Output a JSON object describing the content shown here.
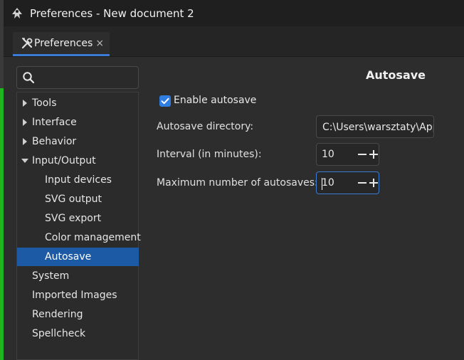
{
  "window": {
    "title": "Preferences - New document 2"
  },
  "tab": {
    "label": "Preferences",
    "close": "×"
  },
  "search": {
    "placeholder": "",
    "value": ""
  },
  "tree": [
    {
      "label": "Tools",
      "expandable": true,
      "expanded": false
    },
    {
      "label": "Interface",
      "expandable": true,
      "expanded": false
    },
    {
      "label": "Behavior",
      "expandable": true,
      "expanded": false
    },
    {
      "label": "Input/Output",
      "expandable": true,
      "expanded": true
    },
    {
      "label": "Input devices",
      "child": true
    },
    {
      "label": "SVG output",
      "child": true
    },
    {
      "label": "SVG export",
      "child": true
    },
    {
      "label": "Color management",
      "child": true
    },
    {
      "label": "Autosave",
      "child": true,
      "selected": true
    },
    {
      "label": "System"
    },
    {
      "label": "Imported Images"
    },
    {
      "label": "Rendering"
    },
    {
      "label": "Spellcheck"
    }
  ],
  "page": {
    "heading": "Autosave",
    "enable_autosave": {
      "label": "Enable autosave",
      "checked": true
    },
    "directory": {
      "label": "Autosave directory:",
      "value": "C:\\Users\\warsztaty\\AppData"
    },
    "interval": {
      "label": "Interval (in minutes):",
      "value": "10"
    },
    "max_autosaves": {
      "label": "Maximum number of autosaves:",
      "value": "10"
    }
  },
  "colors": {
    "accent": "#3a7bd5",
    "selection": "#1d5aa6",
    "checkbox": "#2f7de1"
  }
}
